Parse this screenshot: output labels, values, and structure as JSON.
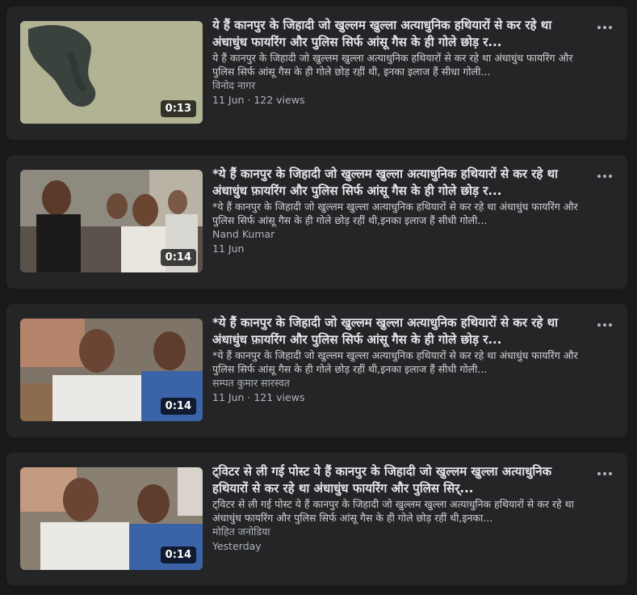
{
  "icons": {
    "more": "more-options-icon"
  },
  "colors": {
    "background": "#18191a",
    "card": "#242526",
    "title": "#e4e6eb",
    "secondary": "#b0b3b8"
  },
  "videos": [
    {
      "title": "ये हैं कानपुर के जिहादी जो खुल्लम खुल्ला अत्याधुनिक हथियारों से कर रहे था अंधाधुंध फायरिंग और पुलिस सिर्फ आंसू गैस के ही गोले छोड़ र...",
      "description": "ये हैं कानपुर के जिहादी जो खुल्लम खुल्ला अत्याधुनिक हथियारों से कर रहे था अंधाधुंध फायरिंग और पुलिस सिर्फ आंसू गैस के ही गोले छोड़ रहीं थी, इनका इलाज हैं सीधा गोली...",
      "author": "विनोद नागर",
      "meta": "11 Jun · 122 views",
      "duration": "0:13"
    },
    {
      "title": "*ये हैं कानपुर के जिहादी जो खुल्लम खुल्ला अत्याधुनिक हथियारों से कर रहे था अंधाधुंध फ़ायरिंग और पुलिस सिर्फ आंसू गैस के ही गोले छोड़ र...",
      "description": "*ये हैं कानपुर के जिहादी जो खुल्लम खुल्ला अत्याधुनिक हथियारों से कर रहे था अंधाधुंध फायरिंग और पुलिस सिर्फ आंसू गैस के ही गोले छोड़ रहीं थी,इनका इलाज हैं सीधी गोली...",
      "author": "Nand Kumar",
      "meta": "11 Jun",
      "duration": "0:14"
    },
    {
      "title": "*ये हैं कानपुर के जिहादी जो खुल्लम खुल्ला अत्याधुनिक हथियारों से कर रहे था अंधाधुंध फ़ायरिंग और पुलिस सिर्फ आंसू गैस के ही गोले छोड़ र...",
      "description": "*ये हैं कानपुर के जिहादी जो खुल्लम खुल्ला अत्याधुनिक हथियारों से कर रहे था अंधाधुंध फायरिंग और पुलिस सिर्फ आंसू गैस के ही गोले छोड़ रहीं थी,इनका इलाज हैं सीधी गोली...",
      "author": "सम्पत कुमार सारस्वत",
      "meta": "11 Jun · 121 views",
      "duration": "0:14"
    },
    {
      "title": "ट्विटर से ली गई पोस्ट ये हैं कानपुर के जिहादी जो खुल्लम खुल्ला अत्याधुनिक हथियारों से कर रहे था अंधाधुंध फायरिंग और पुलिस सिर्...",
      "description": "ट्विटर से ली गई पोस्ट ये हैं कानपुर के जिहादी जो खुल्लम खुल्ला अत्याधुनिक हथियारों से कर रहे था अंधाधुंध फायरिंग और पुलिस सिर्फ आंसू गैस के ही गोले छोड़ रहीं थी,इनका...",
      "author": "मोहित जनोडिया",
      "meta": "Yesterday",
      "duration": "0:14"
    }
  ]
}
